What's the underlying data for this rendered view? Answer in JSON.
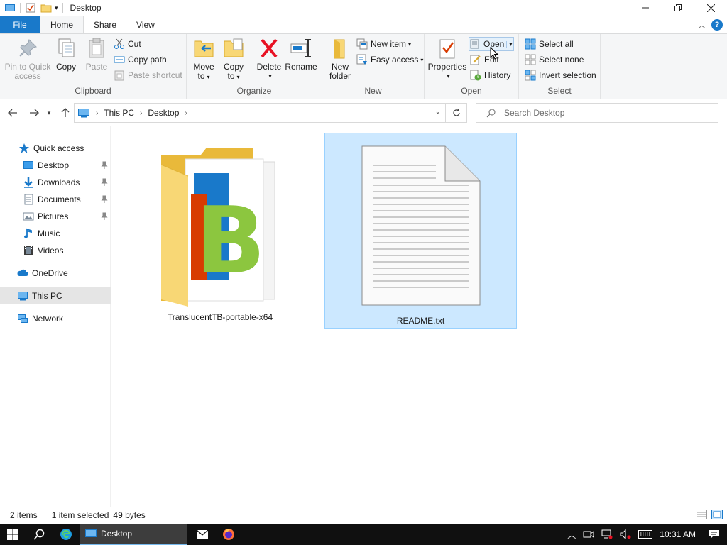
{
  "window": {
    "title": "Desktop"
  },
  "ribbon_tabs": [
    {
      "label": "File"
    },
    {
      "label": "Home"
    },
    {
      "label": "Share"
    },
    {
      "label": "View"
    }
  ],
  "ribbon": {
    "clipboard": {
      "label": "Clipboard",
      "pin_line1": "Pin to Quick",
      "pin_line2": "access",
      "copy": "Copy",
      "paste": "Paste",
      "cut": "Cut",
      "copy_path": "Copy path",
      "paste_shortcut": "Paste shortcut"
    },
    "organize": {
      "label": "Organize",
      "move_to_1": "Move",
      "move_to_2": "to",
      "copy_to_1": "Copy",
      "copy_to_2": "to",
      "delete": "Delete",
      "rename": "Rename"
    },
    "new": {
      "label": "New",
      "new_folder_1": "New",
      "new_folder_2": "folder",
      "new_item": "New item",
      "easy_access": "Easy access"
    },
    "open": {
      "label": "Open",
      "properties": "Properties",
      "open": "Open",
      "edit": "Edit",
      "history": "History"
    },
    "select": {
      "label": "Select",
      "select_all": "Select all",
      "select_none": "Select none",
      "invert_selection": "Invert selection"
    }
  },
  "address": {
    "crumbs": [
      "This PC",
      "Desktop"
    ],
    "search_placeholder": "Search Desktop"
  },
  "nav_pane": {
    "quick_access": "Quick access",
    "items": [
      {
        "label": "Desktop",
        "pinned": true
      },
      {
        "label": "Downloads",
        "pinned": true
      },
      {
        "label": "Documents",
        "pinned": true
      },
      {
        "label": "Pictures",
        "pinned": true
      },
      {
        "label": "Music",
        "pinned": false
      },
      {
        "label": "Videos",
        "pinned": false
      }
    ],
    "onedrive": "OneDrive",
    "this_pc": "This PC",
    "network": "Network"
  },
  "files": [
    {
      "name": "TranslucentTB-portable-x64",
      "type": "folder",
      "selected": false
    },
    {
      "name": "README.txt",
      "type": "text-file",
      "selected": true
    }
  ],
  "status": {
    "item_count": "2 items",
    "selection": "1 item selected",
    "size": "49 bytes"
  },
  "taskbar": {
    "task_label": "Desktop",
    "clock": "10:31 AM"
  },
  "colors": {
    "accent": "#1979ca",
    "selection_bg": "#cce8ff",
    "selection_border": "#99d1ff",
    "taskbar": "#101010"
  }
}
